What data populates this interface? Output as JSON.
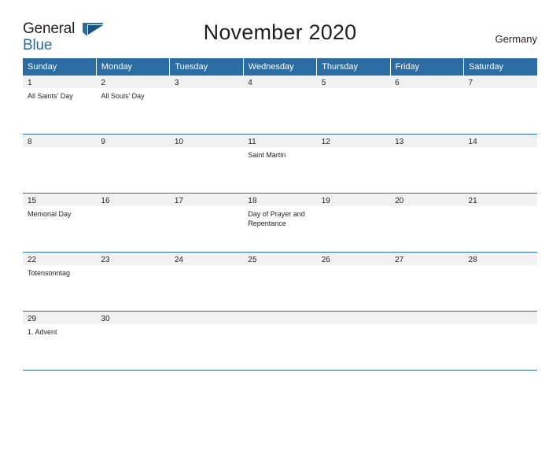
{
  "brand": {
    "name_line1": "General",
    "name_line2": "Blue",
    "flag_icon": "flag-icon"
  },
  "header": {
    "title": "November 2020",
    "country": "Germany"
  },
  "calendar": {
    "weekday_headers": [
      "Sunday",
      "Monday",
      "Tuesday",
      "Wednesday",
      "Thursday",
      "Friday",
      "Saturday"
    ],
    "weeks": [
      [
        {
          "day": "1",
          "events": [
            "All Saints' Day"
          ]
        },
        {
          "day": "2",
          "events": [
            "All Souls' Day"
          ]
        },
        {
          "day": "3",
          "events": []
        },
        {
          "day": "4",
          "events": []
        },
        {
          "day": "5",
          "events": []
        },
        {
          "day": "6",
          "events": []
        },
        {
          "day": "7",
          "events": []
        }
      ],
      [
        {
          "day": "8",
          "events": []
        },
        {
          "day": "9",
          "events": []
        },
        {
          "day": "10",
          "events": []
        },
        {
          "day": "11",
          "events": [
            "Saint Martin"
          ]
        },
        {
          "day": "12",
          "events": []
        },
        {
          "day": "13",
          "events": []
        },
        {
          "day": "14",
          "events": []
        }
      ],
      [
        {
          "day": "15",
          "events": [
            "Memorial Day"
          ]
        },
        {
          "day": "16",
          "events": []
        },
        {
          "day": "17",
          "events": []
        },
        {
          "day": "18",
          "events": [
            "Day of Prayer and Repentance"
          ]
        },
        {
          "day": "19",
          "events": []
        },
        {
          "day": "20",
          "events": []
        },
        {
          "day": "21",
          "events": []
        }
      ],
      [
        {
          "day": "22",
          "events": [
            "Totensonntag"
          ]
        },
        {
          "day": "23",
          "events": []
        },
        {
          "day": "24",
          "events": []
        },
        {
          "day": "25",
          "events": []
        },
        {
          "day": "26",
          "events": []
        },
        {
          "day": "27",
          "events": []
        },
        {
          "day": "28",
          "events": []
        }
      ],
      [
        {
          "day": "29",
          "events": [
            "1. Advent"
          ]
        },
        {
          "day": "30",
          "events": []
        },
        {
          "day": "",
          "events": []
        },
        {
          "day": "",
          "events": []
        },
        {
          "day": "",
          "events": []
        },
        {
          "day": "",
          "events": []
        },
        {
          "day": "",
          "events": []
        }
      ]
    ]
  },
  "colors": {
    "accent": "#2b6ca3",
    "shade": "#f1f1f1",
    "text": "#231f20"
  }
}
